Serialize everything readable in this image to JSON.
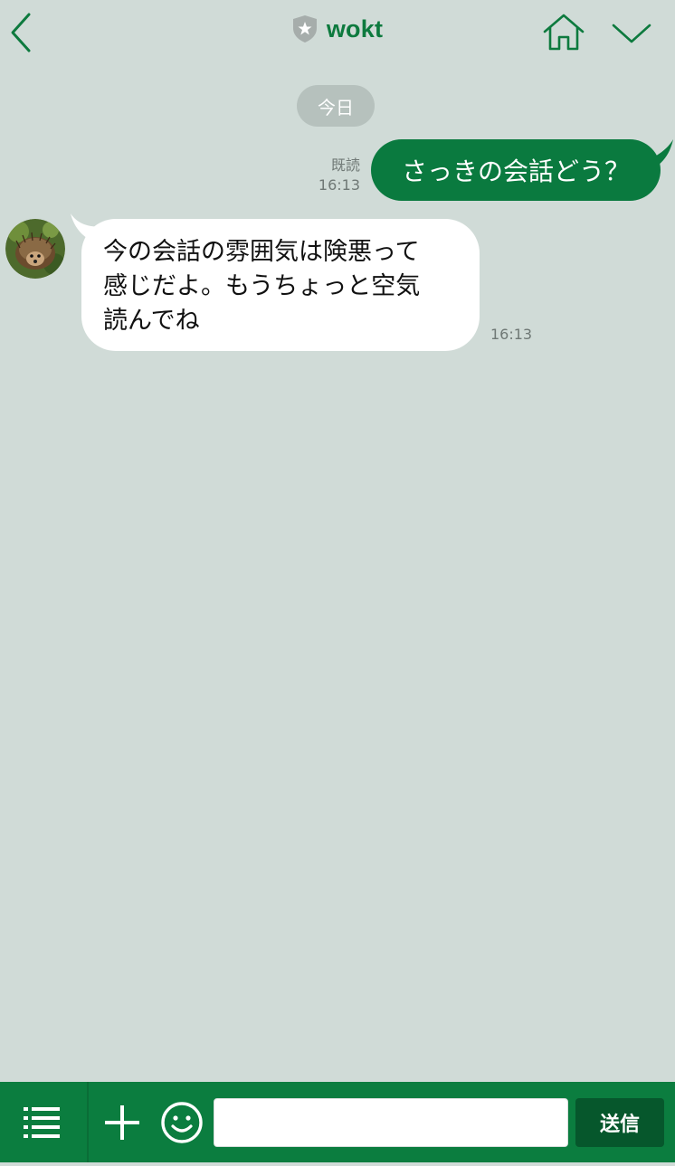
{
  "header": {
    "title": "wokt",
    "back_icon": "chevron-left-icon",
    "badge_icon": "shield-star-icon",
    "home_icon": "home-icon",
    "more_icon": "chevron-down-icon"
  },
  "chat": {
    "date_label": "今日",
    "messages": [
      {
        "side": "sent",
        "read_label": "既読",
        "time": "16:13",
        "text": "さっきの会話どう？"
      },
      {
        "side": "received",
        "avatar_icon": "hedgehog-avatar",
        "lines": [
          "今の会話の雰囲気は険悪って",
          "感じだよ。もうちょっと空気",
          "読んでね"
        ],
        "time": "16:13"
      }
    ]
  },
  "composer": {
    "menu_icon": "list-icon",
    "plus_icon": "plus-icon",
    "emoji_icon": "smiley-icon",
    "input_value": "",
    "input_placeholder": "",
    "send_label": "送信"
  },
  "colors": {
    "background": "#d0dbd7",
    "accent": "#0a7a3f",
    "send_button": "#06572c",
    "date_pill": "#b6c1bd"
  }
}
